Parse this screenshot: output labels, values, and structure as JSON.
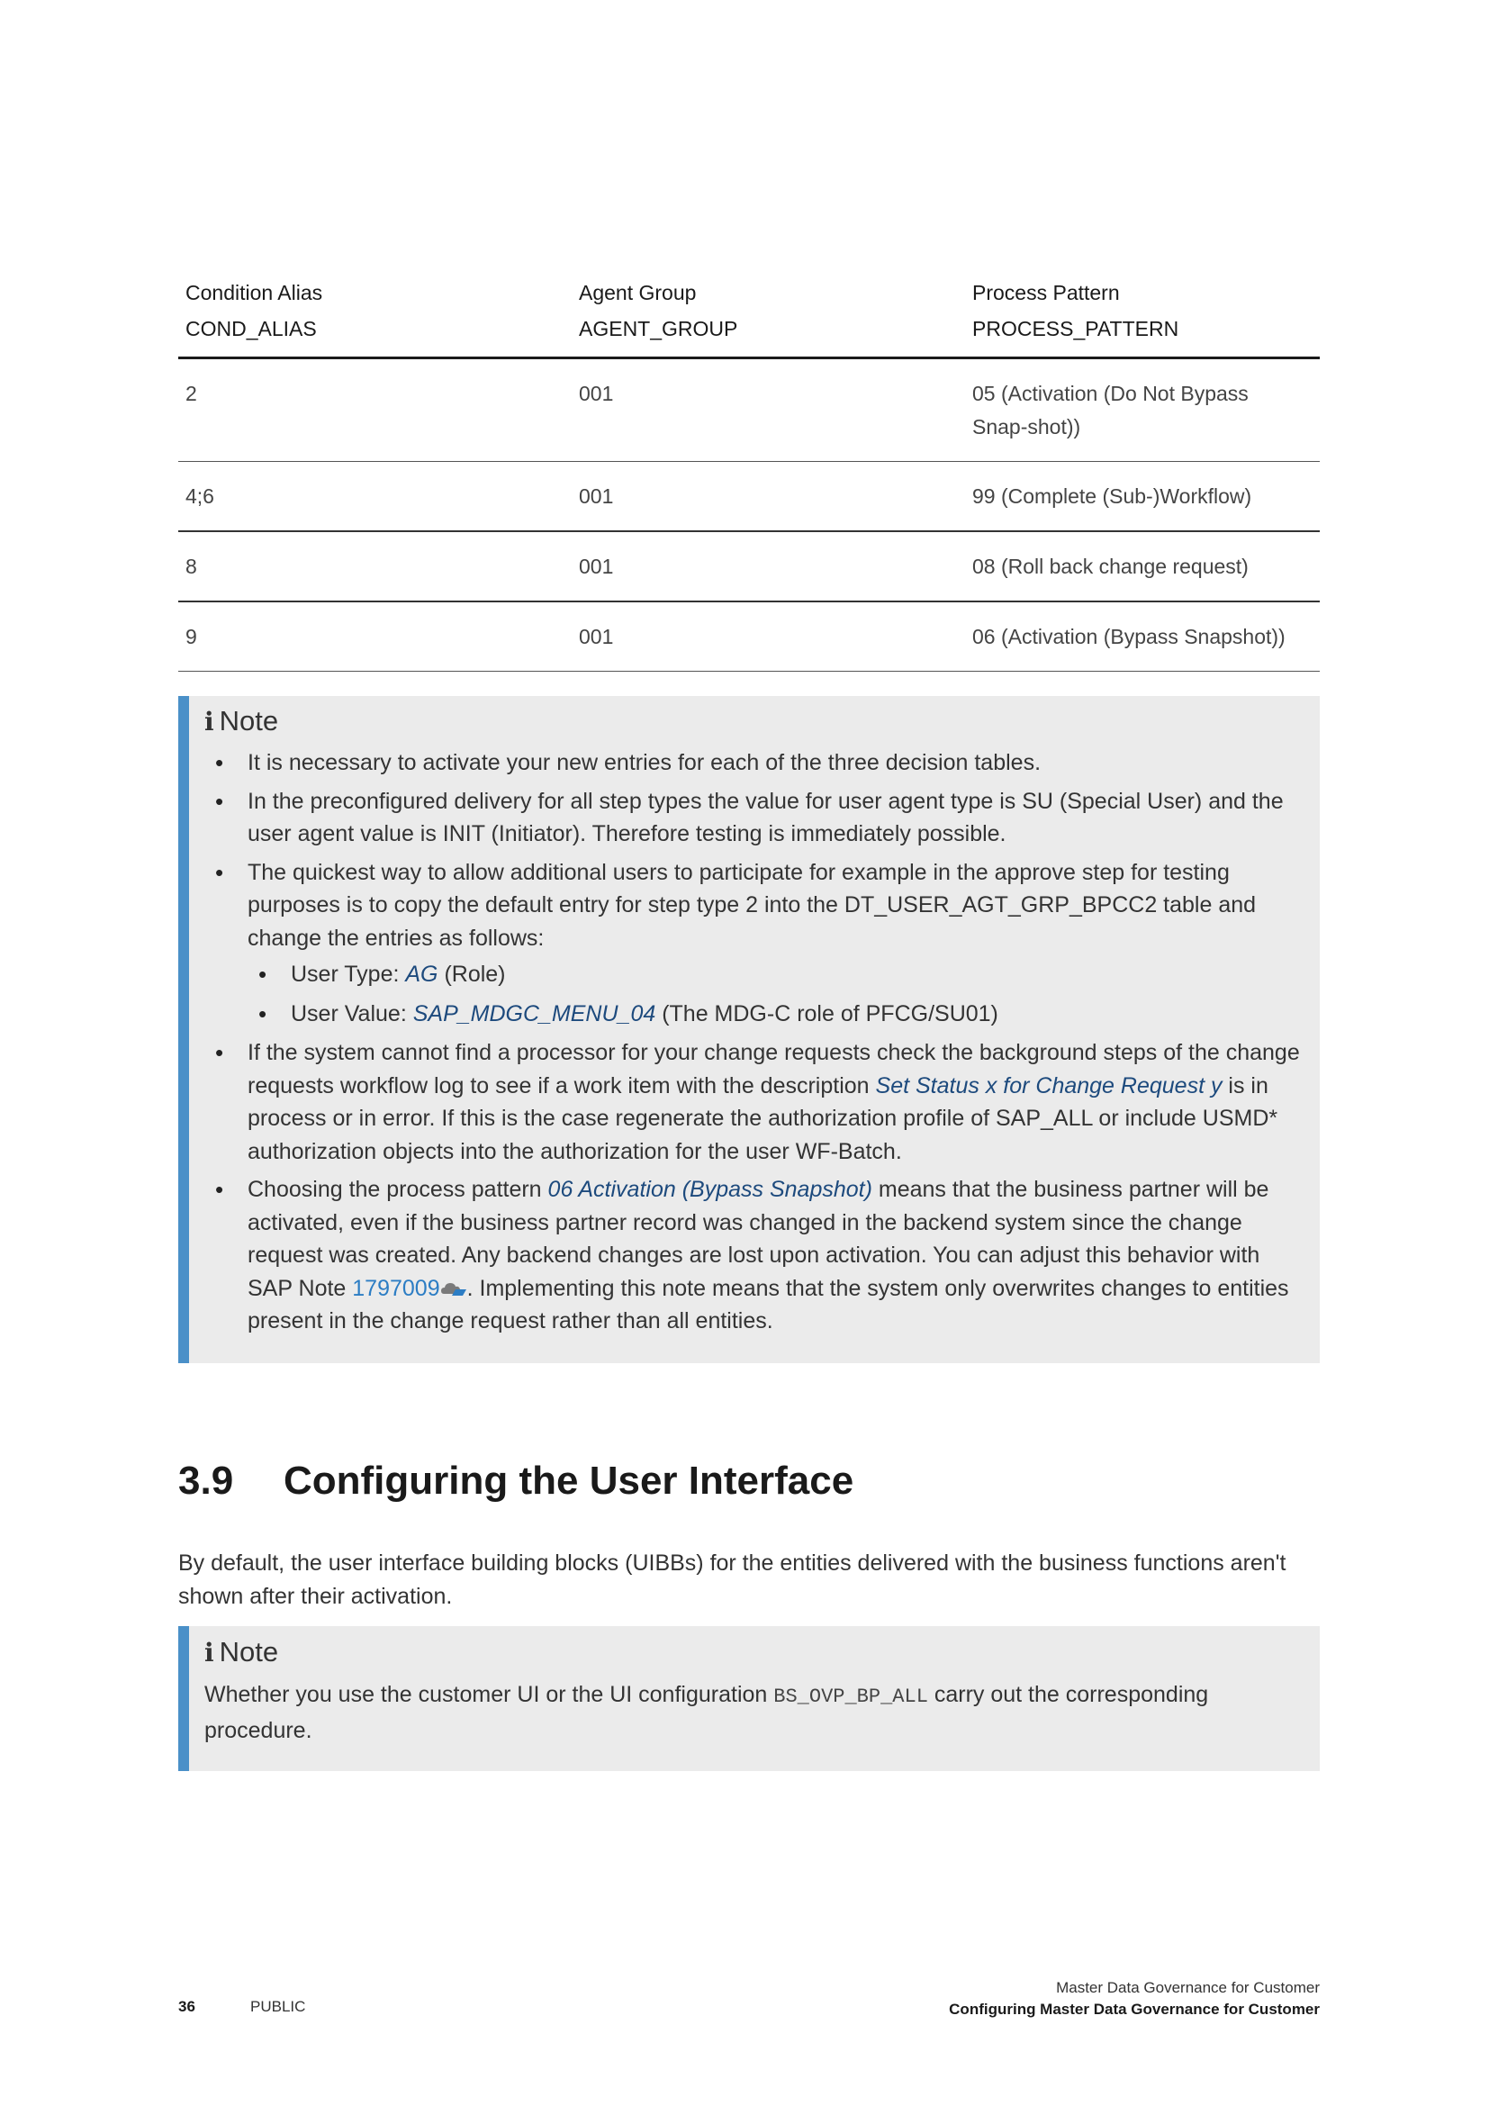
{
  "table": {
    "headers": [
      {
        "label": "Condition Alias",
        "field": "COND_ALIAS"
      },
      {
        "label": "Agent Group",
        "field": "AGENT_GROUP"
      },
      {
        "label": "Process Pattern",
        "field": "PROCESS_PATTERN"
      }
    ],
    "rows": [
      [
        "2",
        "001",
        "05 (Activation (Do Not Bypass Snap-shot))"
      ],
      [
        "4;6",
        "001",
        "99 (Complete (Sub-)Workflow)"
      ],
      [
        "8",
        "001",
        "08 (Roll back change request)"
      ],
      [
        "9",
        "001",
        "06 (Activation (Bypass Snapshot))"
      ]
    ]
  },
  "note1": {
    "icon": "i",
    "title": "Note",
    "bullet1": "It is necessary to activate your new entries for each of the three decision tables.",
    "bullet2": "In the preconfigured delivery for all step types the value for user agent type is SU (Special User) and the user agent value is INIT (Initiator). Therefore testing is immediately possible.",
    "bullet3": "The quickest way to allow additional users to participate for example in the approve step for testing purposes is to copy the default entry for step type 2 into the DT_USER_AGT_GRP_BPCC2 table and change the entries as follows:",
    "sub1_prefix": "User Type: ",
    "sub1_link": "AG",
    "sub1_suffix": " (Role)",
    "sub2_prefix": "User Value: ",
    "sub2_link": "SAP_MDGC_MENU_04",
    "sub2_suffix": " (The MDG-C role of PFCG/SU01)",
    "bullet4_prefix": "If the system cannot find a processor for your change requests check the background steps of the change requests workflow log to see if a work item with the description ",
    "bullet4_link": "Set Status x for Change Request y",
    "bullet4_suffix": " is in process or in error. If this is the case regenerate the authorization profile of SAP_ALL or include USMD* authorization objects into the authorization for the user WF-Batch.",
    "bullet5_prefix": "Choosing the process pattern ",
    "bullet5_link": "06 Activation (Bypass Snapshot)",
    "bullet5_mid": " means that the business partner will be activated, even if the business partner record was changed in the backend system since the change request was created. Any backend changes are lost upon activation. You can adjust this behavior with SAP Note ",
    "bullet5_note": "1797009",
    "bullet5_suffix": ". Implementing this note means that the system only overwrites changes to entities present in the change request rather than all entities."
  },
  "section": {
    "number": "3.9",
    "title": "Configuring the User Interface",
    "body": "By default, the user interface building blocks (UIBBs) for the entities delivered with the business functions aren't shown after their activation."
  },
  "note2": {
    "icon": "i",
    "title": "Note",
    "prefix": "Whether you use the customer UI or the UI configuration ",
    "code": "BS_OVP_BP_ALL",
    "suffix": " carry out the corresponding procedure."
  },
  "footer": {
    "page": "36",
    "classification": "PUBLIC",
    "doc_title": "Master Data Governance for Customer",
    "chapter": "Configuring Master Data Governance for Customer"
  },
  "colors": {
    "accent": "#4a90c8",
    "link": "#1d4a7d",
    "note_bg": "#ebebeb"
  }
}
